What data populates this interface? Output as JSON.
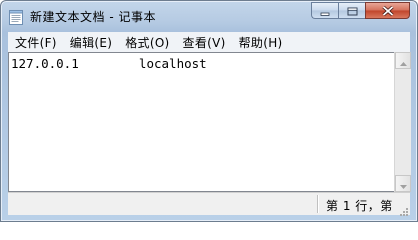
{
  "window": {
    "title": "新建文本文档 - 记事本",
    "icon": "notepad-icon",
    "controls": [
      "minimize-icon",
      "maximize-icon",
      "close-icon"
    ]
  },
  "menu": [
    {
      "label": "文件(F)"
    },
    {
      "label": "编辑(E)"
    },
    {
      "label": "格式(O)"
    },
    {
      "label": "查看(V)"
    },
    {
      "label": "帮助(H)"
    }
  ],
  "editor": {
    "content": "127.0.0.1        localhost"
  },
  "status": {
    "position_text": "第 1 行，第"
  },
  "colors": {
    "titlebar": "#b9cde4",
    "close_button": "#c0442a",
    "menubar": "#f0f3f7",
    "editor_bg": "#ffffff"
  }
}
